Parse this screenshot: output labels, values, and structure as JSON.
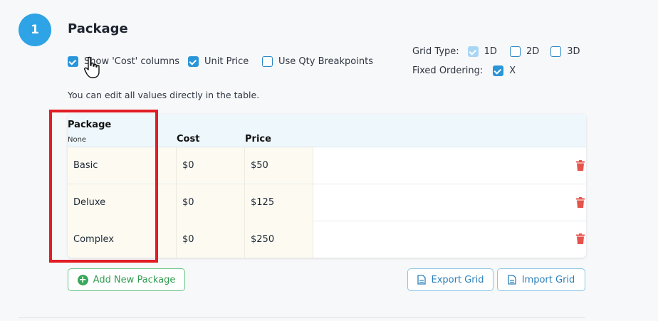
{
  "step": {
    "number": "1",
    "title": "Package"
  },
  "options": {
    "show_cost": {
      "label": "Show 'Cost' columns",
      "checked": true
    },
    "unit_price": {
      "label": "Unit Price",
      "checked": true
    },
    "qty_breakpoints": {
      "label": "Use Qty Breakpoints",
      "checked": false
    }
  },
  "grid_type": {
    "label": "Grid Type:",
    "options": [
      {
        "label": "1D",
        "checked": true
      },
      {
        "label": "2D",
        "checked": false
      },
      {
        "label": "3D",
        "checked": false
      }
    ]
  },
  "fixed_ordering": {
    "label": "Fixed Ordering:",
    "option": "X",
    "checked": true
  },
  "hint": "You can edit all values directly in the table.",
  "table": {
    "headers": {
      "package": "Package",
      "package_sub": "None",
      "cost": "Cost",
      "price": "Price"
    },
    "rows": [
      {
        "name": "Basic",
        "cost": "$0",
        "price": "$50"
      },
      {
        "name": "Deluxe",
        "cost": "$0",
        "price": "$125"
      },
      {
        "name": "Complex",
        "cost": "$0",
        "price": "$250"
      }
    ]
  },
  "buttons": {
    "add": "Add New Package",
    "export": "Export Grid",
    "import": "Import Grid"
  },
  "icons": {
    "trash": "trash-icon",
    "add": "plus-circle-icon",
    "document": "document-icon",
    "cursor": "hand-pointer-icon"
  },
  "colors": {
    "accent": "#2ea3e6",
    "checkbox": "#2a96d8",
    "delete": "#e5534b",
    "add_green": "#2f9b4f",
    "highlight": "#e21d24"
  }
}
